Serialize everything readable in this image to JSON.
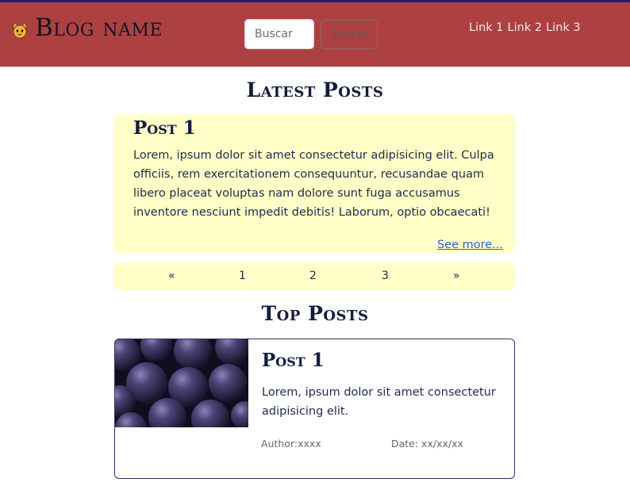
{
  "header": {
    "brand_icon": "cat-face-icon",
    "brand_name": "Blog name",
    "search_placeholder": "Buscar",
    "search_button": "Buscar",
    "nav_links": [
      "Link 1",
      "Link 2",
      "Link 3"
    ],
    "colors": {
      "header_bg": "#ad4141",
      "top_line": "#22226b"
    }
  },
  "latest": {
    "title": "Latest Posts",
    "post": {
      "title": "Post 1",
      "body": "Lorem, ipsum dolor sit amet consectetur adipisicing elit. Culpa officiis, rem exercitationem consequuntur, recusandae quam libero placeat voluptas nam dolore sunt fuga accusamus inventore nesciunt impedit debitis! Laborum, optio obcaecati!",
      "see_more": "See more..."
    },
    "card_color": "#ffffc8"
  },
  "pagination": {
    "prev": "«",
    "pages": [
      "1",
      "2",
      "3"
    ],
    "next": "»"
  },
  "top": {
    "title": "Top Posts",
    "post": {
      "image_icon": "plums-photo",
      "title": "Post 1",
      "body": "Lorem, ipsum dolor sit amet consectetur adipisicing elit.",
      "author": "Author:xxxx",
      "date": "Date: xx/xx/xx"
    }
  }
}
